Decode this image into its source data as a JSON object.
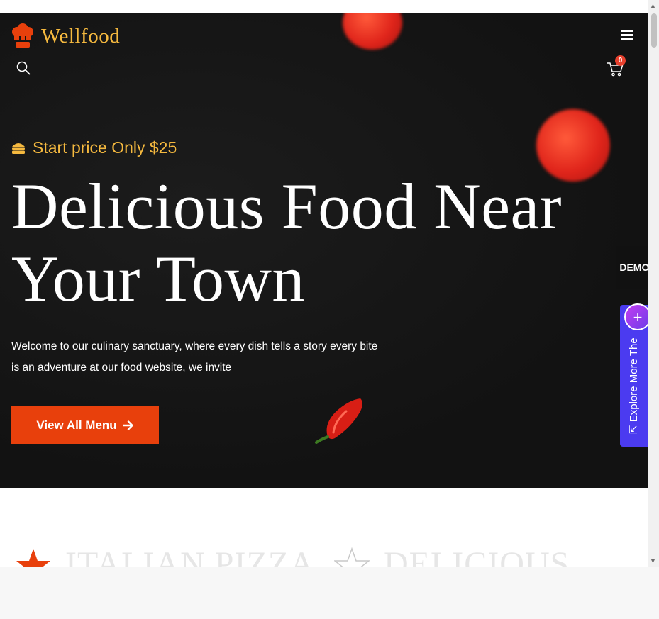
{
  "brand": {
    "name": "Wellfood",
    "accent": "#f5b93f",
    "cta_color": "#e8400c"
  },
  "header": {
    "cart_count": "0"
  },
  "hero": {
    "tagline": "Start price Only $25",
    "headline_line1": "Delicious Food Near",
    "headline_line2": "Your Town",
    "description": "Welcome to our culinary sanctuary, where every dish tells a story every bite is an adventure at our food website, we invite",
    "cta_label": "View All Menu"
  },
  "side_tabs": {
    "demos_label": "DEMOS",
    "explore_label": "Explore More The"
  },
  "features": [
    {
      "title": "ITALIAN PIZZA"
    },
    {
      "title": "DELICIOUS"
    }
  ],
  "icons": {
    "logo": "chef-hat-icon",
    "menu": "hamburger-menu-icon",
    "search": "search-icon",
    "cart": "cart-icon",
    "tagline": "burger-icon",
    "cta": "arrow-right-icon",
    "explore": "arrow-up-icon",
    "explore_plus": "plus-icon",
    "feature": "star-icon"
  }
}
